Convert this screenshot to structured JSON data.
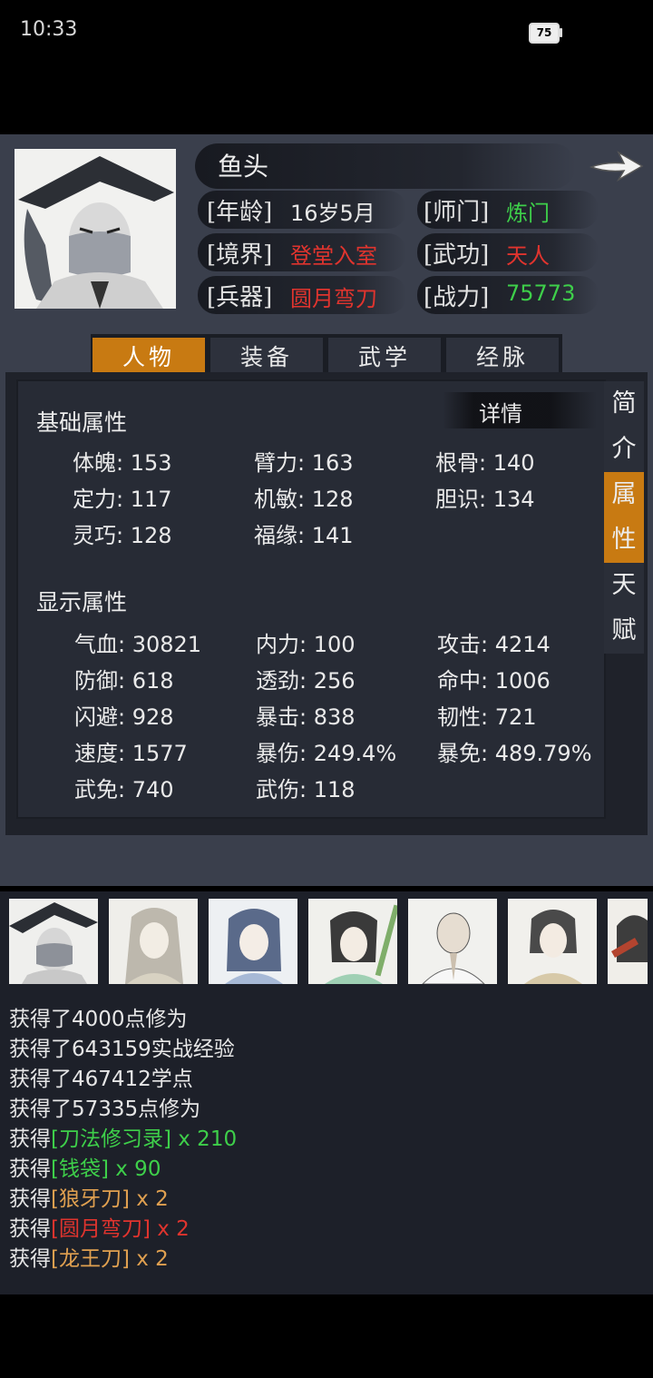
{
  "status_bar": {
    "time": "10:33",
    "battery": "75"
  },
  "character": {
    "name": "鱼头",
    "age_label": "[年龄]",
    "age": "16岁5月",
    "sect_label": "[师门]",
    "sect": "炼门",
    "realm_label": "[境界]",
    "realm": "登堂入室",
    "martial_label": "[武功]",
    "martial": "天人",
    "weapon_label": "[兵器]",
    "weapon": "圆月弯刀",
    "power_label": "[战力]",
    "power": "75773"
  },
  "tabs": [
    "人物",
    "装备",
    "武学",
    "经脉"
  ],
  "side_tabs": [
    {
      "c1": "简",
      "c2": "介"
    },
    {
      "c1": "属",
      "c2": "性"
    },
    {
      "c1": "天",
      "c2": "赋"
    }
  ],
  "details_label": "详情",
  "base_title": "基础属性",
  "base_stats": [
    "体魄: 153",
    "臂力: 163",
    "根骨: 140",
    "定力: 117",
    "机敏: 128",
    "胆识: 134",
    "灵巧: 128",
    "福缘: 141"
  ],
  "display_title": "显示属性",
  "display_stats": [
    "气血: 30821",
    "内力: 100",
    "攻击: 4214",
    "防御: 618",
    "透劲: 256",
    "命中: 1006",
    "闪避: 928",
    "暴击: 838",
    "韧性: 721",
    "速度: 1577",
    "暴伤: 249.4%",
    "暴免: 489.79%",
    "武免: 740",
    "武伤: 118"
  ],
  "log": [
    {
      "text": "获得了4000点修为"
    },
    {
      "text": "获得了643159实战经验"
    },
    {
      "text": "获得了467412学点"
    },
    {
      "text": "获得了57335点修为"
    },
    {
      "prefix": "获得",
      "item": "[刀法修习录] x 210"
    },
    {
      "prefix": "获得",
      "item": "[钱袋] x 90"
    },
    {
      "prefix": "获得",
      "item": "[狼牙刀] x 2"
    },
    {
      "prefix": "获得",
      "item": "[圆月弯刀] x 2"
    },
    {
      "prefix": "获得",
      "item": "[龙王刀] x 2"
    }
  ],
  "colors": {
    "accent": "#c87a12",
    "green": "#3ecf4a",
    "red": "#e0342e",
    "orange": "#e0a050",
    "panel": "#3a3f4c"
  }
}
